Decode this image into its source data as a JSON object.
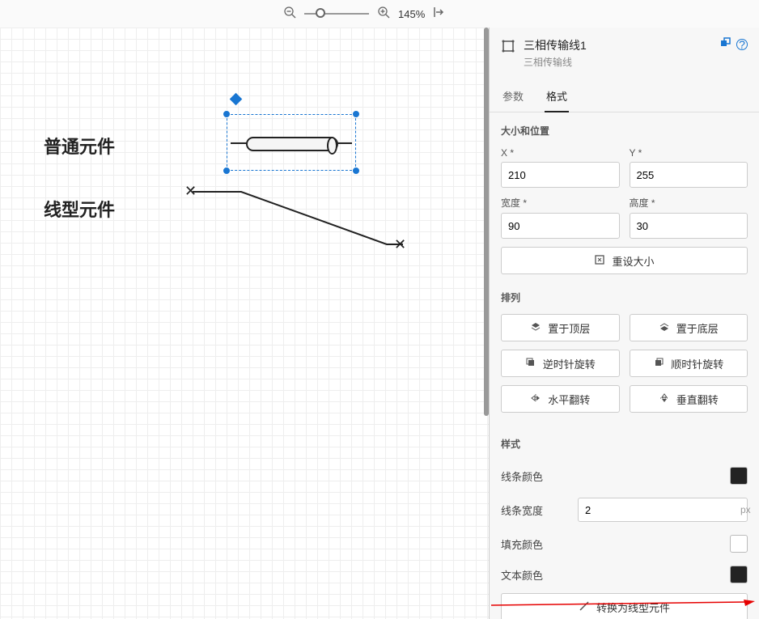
{
  "toolbar": {
    "zoom_value": "145%"
  },
  "canvas": {
    "label_normal": "普通元件",
    "label_line": "线型元件"
  },
  "panel": {
    "title": "三相传输线1",
    "subtitle": "三相传输线",
    "tabs": {
      "params_label": "参数",
      "format_label": "格式"
    },
    "size_section": {
      "title": "大小和位置",
      "x_label": "X *",
      "y_label": "Y *",
      "x_value": "210",
      "y_value": "255",
      "w_label": "宽度 *",
      "h_label": "高度 *",
      "w_value": "90",
      "h_value": "30",
      "reset_label": "重设大小"
    },
    "arrange_section": {
      "title": "排列",
      "to_front": "置于顶层",
      "to_back": "置于底层",
      "rotate_ccw": "逆时针旋转",
      "rotate_cw": "顺时针旋转",
      "flip_h": "水平翻转",
      "flip_v": "垂直翻转"
    },
    "style_section": {
      "title": "样式",
      "line_color": "线条颜色",
      "line_width": "线条宽度",
      "line_width_value": "2",
      "line_width_unit": "px",
      "fill_color": "填充颜色",
      "text_color": "文本颜色",
      "convert_label": "转换为线型元件"
    }
  }
}
